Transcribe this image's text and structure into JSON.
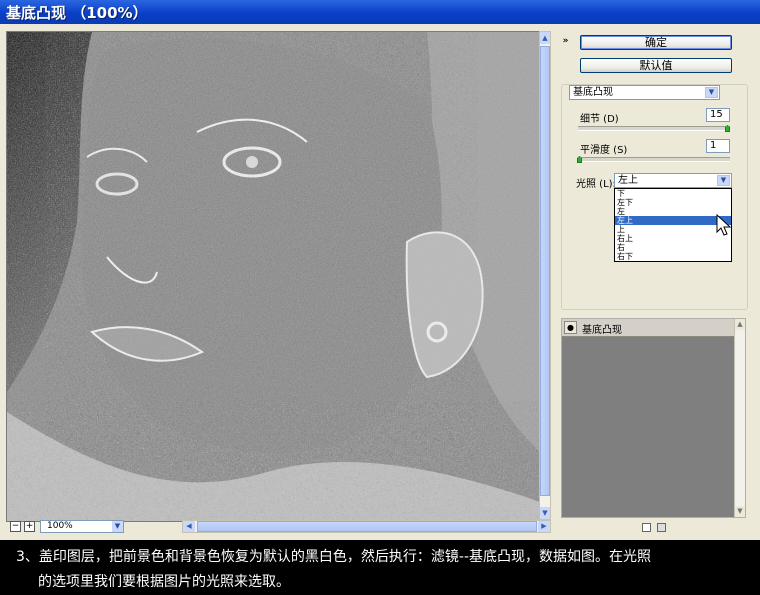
{
  "window": {
    "title": "基底凸现 （100%）"
  },
  "preview": {
    "zoom": "100%"
  },
  "buttons": {
    "ok": "确定",
    "default_value": "默认值"
  },
  "filter": {
    "selected_filter": "基底凸现",
    "detail": {
      "label": "细节 (D)",
      "value": "15",
      "fraction": 1.0
    },
    "smoothness": {
      "label": "平滑度 (S)",
      "value": "1",
      "fraction": 0.0
    },
    "light": {
      "label": "光照 (L):",
      "value": "左上",
      "options": [
        "下",
        "左下",
        "左",
        "左上",
        "上",
        "右上",
        "右",
        "右下"
      ],
      "highlighted": "左上"
    }
  },
  "effect_layers": [
    {
      "name": "基底凸现",
      "visible": true
    }
  ],
  "icons": {
    "collapse": "double-chevron-up-icon",
    "visibility": "eye-icon",
    "new_layer": "new-effect-layer-icon",
    "delete_layer": "trash-icon",
    "cursor": "mouse-pointer-icon"
  },
  "caption": {
    "line1": "3、盖印图层，把前景色和背景色恢复为默认的黑白色，然后执行：滤镜--基底凸现，数据如图。在光照",
    "line2": "的选项里我们要根据图片的光照来选取。"
  }
}
